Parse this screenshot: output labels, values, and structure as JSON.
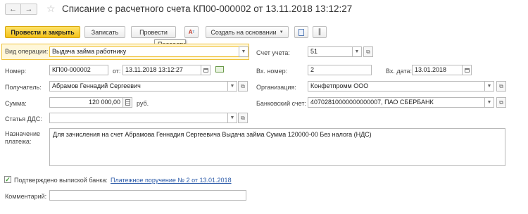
{
  "window": {
    "title": "Списание с расчетного счета КП00-000002 от 13.11.2018 13:12:27"
  },
  "toolbar": {
    "post_and_close": "Провести и закрыть",
    "save": "Записать",
    "post": "Провести",
    "create_based_on": "Создать на основании",
    "tooltip": "Провести"
  },
  "form": {
    "operation_type": {
      "label": "Вид операции:",
      "value": "Выдача займа работнику"
    },
    "account": {
      "label": "Счет учета:",
      "value": "51"
    },
    "number": {
      "label": "Номер:",
      "value": "КП00-000002"
    },
    "date": {
      "label": "от:",
      "value": "13.11.2018 13:12:27"
    },
    "in_number": {
      "label": "Вх. номер:",
      "value": "2"
    },
    "in_date": {
      "label": "Вх. дата:",
      "value": "13.01.2018"
    },
    "recipient": {
      "label": "Получатель:",
      "value": "Абрамов Геннадий Сергеевич"
    },
    "organization": {
      "label": "Организация:",
      "value": "Конфетпромм ООО"
    },
    "amount": {
      "label": "Сумма:",
      "value": "120 000,00",
      "currency": "руб."
    },
    "bank_account": {
      "label": "Банковский счет:",
      "value": "40702810000000000007, ПАО СБЕРБАНК"
    },
    "dds_item": {
      "label": "Статья ДДС:",
      "value": ""
    },
    "purpose": {
      "label": "Назначение платежа:",
      "value": "Для зачисления на счет Абрамова Геннадия Сергеевича Выдача займа Сумма 120000-00 Без налога (НДС)"
    },
    "confirmed": {
      "label": "Подтверждено выпиской банка:",
      "link": "Платежное поручение № 2 от 13.01.2018",
      "checked": true
    },
    "comment": {
      "label": "Комментарий:",
      "value": ""
    }
  },
  "colors": {
    "primary_button": "#f4c21a",
    "focus_border": "#f0c33c",
    "link": "#2b5aa8",
    "check": "#3a9a2a"
  }
}
